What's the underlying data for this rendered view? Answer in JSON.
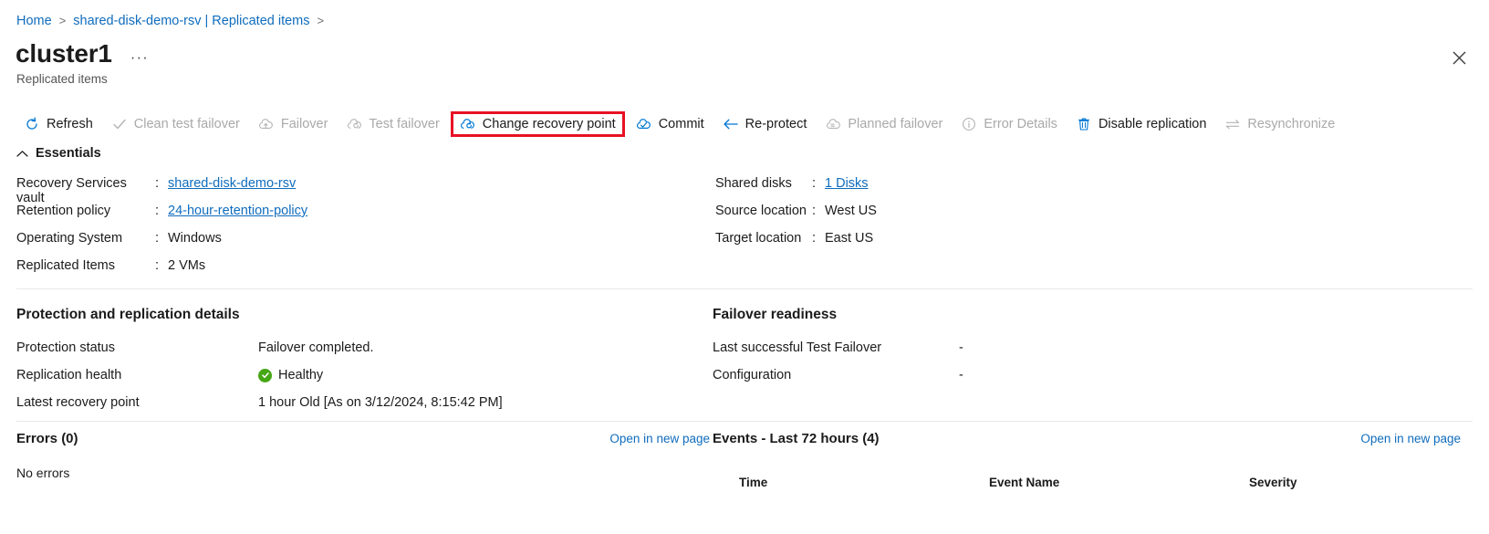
{
  "breadcrumb": {
    "items": [
      {
        "label": "Home",
        "sep": ">"
      },
      {
        "label": "shared-disk-demo-rsv | Replicated items",
        "sep": ">"
      }
    ]
  },
  "header": {
    "title": "cluster1",
    "more_label": "···",
    "subtitle": "Replicated items",
    "close_label": "✕"
  },
  "toolbar": {
    "items": [
      {
        "label": "Refresh",
        "icon": "refresh-icon",
        "disabled": false,
        "highlighted": false
      },
      {
        "label": "Clean test failover",
        "icon": "checkmark-icon",
        "disabled": true,
        "highlighted": false
      },
      {
        "label": "Failover",
        "icon": "cloud-up-arrow-icon",
        "disabled": true,
        "highlighted": false
      },
      {
        "label": "Test failover",
        "icon": "cloud-refresh-icon",
        "disabled": true,
        "highlighted": false
      },
      {
        "label": "Change recovery point",
        "icon": "cloud-refresh-icon",
        "disabled": false,
        "highlighted": true
      },
      {
        "label": "Commit",
        "icon": "cloud-check-icon",
        "disabled": false,
        "highlighted": false
      },
      {
        "label": "Re-protect",
        "icon": "arrow-left-icon",
        "disabled": false,
        "highlighted": false
      },
      {
        "label": "Planned failover",
        "icon": "cloud-planned-icon",
        "disabled": true,
        "highlighted": false
      },
      {
        "label": "Error Details",
        "icon": "info-circle-icon",
        "disabled": true,
        "highlighted": false
      },
      {
        "label": "Disable replication",
        "icon": "trash-icon",
        "disabled": false,
        "highlighted": false
      },
      {
        "label": "Resynchronize",
        "icon": "two-way-arrows-icon",
        "disabled": true,
        "highlighted": false
      }
    ],
    "highlight_color": "#e81123"
  },
  "essentials": {
    "header": "Essentials",
    "left": [
      {
        "label": "Recovery Services vault",
        "colon": ":",
        "value": "shared-disk-demo-rsv",
        "link": true
      },
      {
        "label": "Retention policy",
        "colon": ":",
        "value": "24-hour-retention-policy",
        "link": true
      },
      {
        "label": "Operating System",
        "colon": ":",
        "value": "Windows",
        "link": false
      },
      {
        "label": "Replicated Items",
        "colon": ":",
        "value": "2 VMs",
        "link": false
      }
    ],
    "right": [
      {
        "label": "Shared disks",
        "colon": ":",
        "value": "1 Disks",
        "link": true
      },
      {
        "label": "Source location",
        "colon": ":",
        "value": "West US",
        "link": false
      },
      {
        "label": "Target location",
        "colon": ":",
        "value": "East US",
        "link": false
      }
    ]
  },
  "protection": {
    "title": "Protection and replication details",
    "rows": [
      {
        "key": "Protection status",
        "value": "Failover completed.",
        "status": false
      },
      {
        "key": "Replication health",
        "value": "Healthy",
        "status": true
      },
      {
        "key": "Latest recovery point",
        "value": "1 hour Old [As on 3/12/2024, 8:15:42 PM]",
        "status": false
      }
    ],
    "status_color": "#46a716"
  },
  "readiness": {
    "title": "Failover readiness",
    "rows": [
      {
        "key": "Last successful Test Failover",
        "value": "-"
      },
      {
        "key": "Configuration",
        "value": "-"
      }
    ]
  },
  "errors_panel": {
    "title": "Errors (0)",
    "link": "Open in new page",
    "body": "No errors"
  },
  "events_panel": {
    "title": "Events - Last 72 hours (4)",
    "link": "Open in new page",
    "columns": [
      "Time",
      "Event Name",
      "Severity"
    ],
    "rows": []
  },
  "colors": {
    "link": "#0f6cbd",
    "text": "#1b1b1b",
    "muted": "#a9a9a9",
    "accent_blue": "#0078d4",
    "highlight_red": "#e81123",
    "healthy_green": "#46a716"
  }
}
